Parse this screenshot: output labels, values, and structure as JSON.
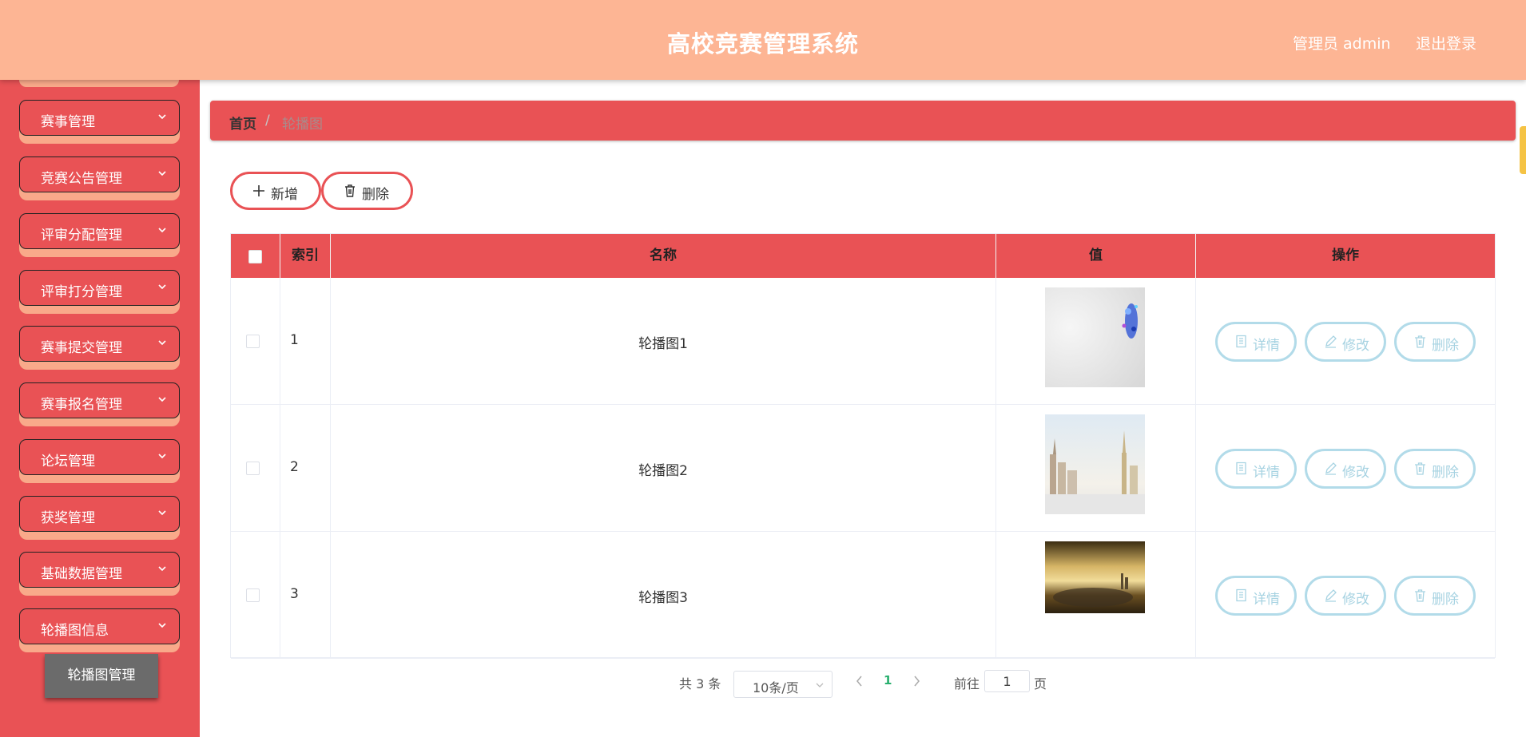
{
  "header": {
    "title": "高校竞赛管理系统",
    "user": "管理员 admin",
    "logout": "退出登录"
  },
  "sidebar": {
    "items": [
      {
        "label": "赛事管理"
      },
      {
        "label": "竞赛公告管理"
      },
      {
        "label": "评审分配管理"
      },
      {
        "label": "评审打分管理"
      },
      {
        "label": "赛事提交管理"
      },
      {
        "label": "赛事报名管理"
      },
      {
        "label": "论坛管理"
      },
      {
        "label": "获奖管理"
      },
      {
        "label": "基础数据管理"
      },
      {
        "label": "轮播图信息"
      }
    ],
    "submenu": {
      "label": "轮播图管理"
    }
  },
  "breadcrumb": {
    "home": "首页",
    "separator": "/",
    "current": "轮播图"
  },
  "toolbar": {
    "add_label": "新增",
    "delete_label": "删除"
  },
  "table": {
    "headers": {
      "index": "索引",
      "name": "名称",
      "value": "值",
      "ops": "操作"
    },
    "rows": [
      {
        "index": "1",
        "name": "轮播图1",
        "image": "abstract-blue-splash"
      },
      {
        "index": "2",
        "name": "轮播图2",
        "image": "city-skyline"
      },
      {
        "index": "3",
        "name": "轮播图3",
        "image": "golden-sky-road"
      }
    ],
    "actions": {
      "detail": "详情",
      "edit": "修改",
      "delete": "删除"
    }
  },
  "pagination": {
    "total": "共 3 条",
    "page_size": "10条/页",
    "current_page": "1",
    "goto_label": "前往",
    "goto_value": "1",
    "page_unit": "页"
  },
  "colors": {
    "header": "#fdb594",
    "primary": "#e95255",
    "menu_shadow": "#f9a98a",
    "action_border": "#b2dbe9",
    "active_page": "#2ab06f"
  }
}
